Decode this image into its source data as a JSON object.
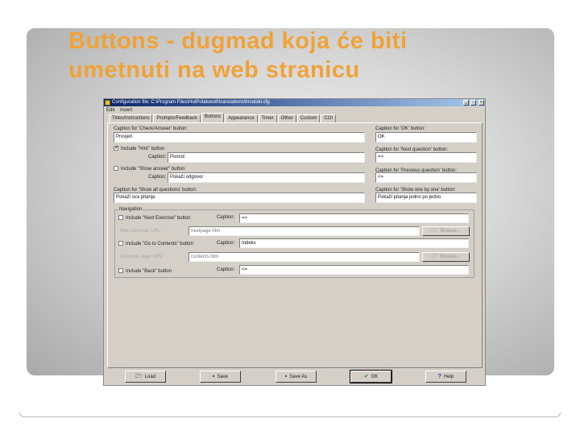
{
  "slide": {
    "title_line1": "Buttons - dugmad koja će biti",
    "title_line2": "umetnuti na web stranicu"
  },
  "window": {
    "title": "Configuration file: C:\\Program Files\\HotPotatoes6\\translations\\hrvatski.cfg",
    "min": "_",
    "max": "▫",
    "close": "×"
  },
  "menu": [
    "Edit",
    "Insert"
  ],
  "tabs": [
    "Titles/Instructions",
    "Prompts/Feedback",
    "Buttons",
    "Appearance",
    "Timer",
    "Other",
    "Custom",
    "CGI"
  ],
  "buttons_tab": {
    "check_label": "Caption for 'Check/Answer' button:",
    "check_value": "Provjeri",
    "hint_include": "Include \"Hint\" button",
    "hint_checked": "✔",
    "hint_caption_label": "Caption:",
    "hint_value": "Pomoć",
    "show_include": "Include \"Show answer\" button",
    "show_caption_label": "Caption:",
    "show_value": "Pokaži odgovor",
    "showall_label": "Caption for 'Show all questions' button:",
    "showall_value": "Pokaži sva pitanja",
    "ok_label": "Caption for 'OK' button:",
    "ok_value": "OK",
    "next_q_label": "Caption for 'Next question' button:",
    "next_q_value": "=>",
    "prev_q_label": "Caption for 'Previous question' button:",
    "prev_q_value": "<=",
    "onebyone_label": "Caption for 'Show one by one' button:",
    "onebyone_value": "Pokaži pitanja jedno po jedno"
  },
  "navigation": {
    "legend": "Navigation",
    "next_include": "Include \"Next Exercise\" button",
    "next_caption_label": "Caption:",
    "next_caption": "=>",
    "next_url_label": "Next exercise URL:",
    "next_url": "nextpage.htm",
    "browse1": "Browse...",
    "contents_include": "Include \"Go to Contents\" button",
    "contents_caption_label": "Caption:",
    "contents_caption": "Indeks",
    "contents_url_label": "Contents page URL:",
    "contents_url": "contents.htm",
    "browse2": "Browse...",
    "back_include": "Include \"Back\" button",
    "back_caption_label": "Caption:",
    "back_caption": "<="
  },
  "footer": {
    "load": "Load",
    "save": "Save",
    "save_as": "Save As",
    "ok": "OK",
    "help": "Help"
  }
}
